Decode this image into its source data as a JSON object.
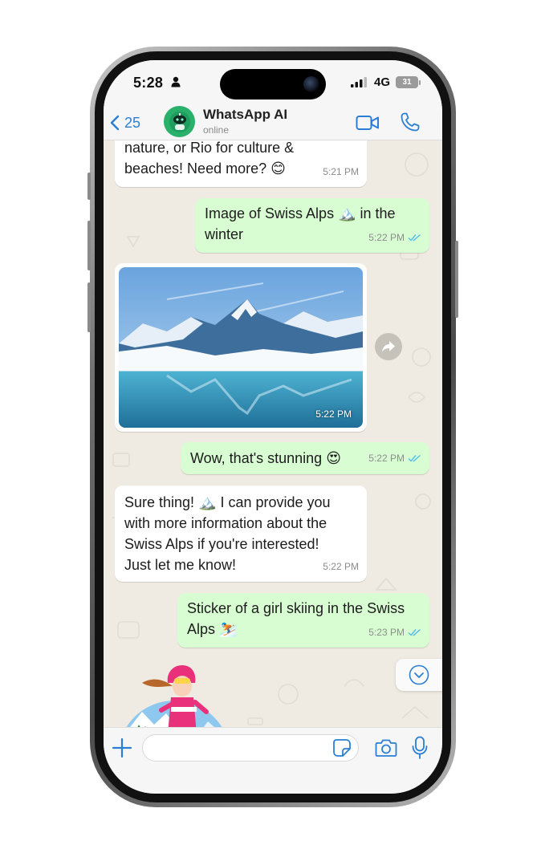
{
  "status_bar": {
    "time": "5:28",
    "network": "4G",
    "battery": "31"
  },
  "header": {
    "back_count": "25",
    "contact_name": "WhatsApp AI",
    "contact_status": "online"
  },
  "messages": [
    {
      "direction": "incoming",
      "lines": [
        "nature, or Rio for culture &",
        "beaches! Need more? 😊"
      ],
      "time": "5:21 PM"
    },
    {
      "direction": "outgoing",
      "lines": [
        "Image of Swiss Alps 🏔️ in the",
        "winter"
      ],
      "time": "5:22 PM",
      "read": true
    },
    {
      "direction": "incoming",
      "type": "image",
      "alt": "Snowy Swiss Alps mountains reflected in a lake",
      "time": "5:22 PM"
    },
    {
      "direction": "outgoing",
      "lines": [
        "Wow, that's stunning 😍"
      ],
      "time": "5:22 PM",
      "read": true
    },
    {
      "direction": "incoming",
      "lines": [
        "Sure thing! 🏔️ I can provide you",
        "with more information about the",
        "Swiss Alps if you're interested!",
        "Just let me know!"
      ],
      "time": "5:22 PM"
    },
    {
      "direction": "outgoing",
      "lines": [
        "Sticker of a girl skiing in the Swiss",
        "Alps ⛷️"
      ],
      "time": "5:23 PM",
      "read": true
    },
    {
      "direction": "incoming",
      "type": "sticker",
      "alt": "girl skiing"
    }
  ],
  "input": {
    "placeholder": ""
  },
  "colors": {
    "outgoing_bubble": "#d9fdd3",
    "incoming_bubble": "#ffffff",
    "accent": "#2a7fd4",
    "read_ticks": "#53bdeb",
    "chat_background": "#efeae2"
  },
  "icons": [
    "person-icon",
    "signal-icon",
    "battery-icon",
    "chevron-left-icon",
    "robot-avatar-icon",
    "video-camera-icon",
    "phone-icon",
    "forward-icon",
    "chevron-down-icon",
    "plus-icon",
    "sticker-icon",
    "camera-icon",
    "microphone-icon",
    "double-check-icon"
  ]
}
